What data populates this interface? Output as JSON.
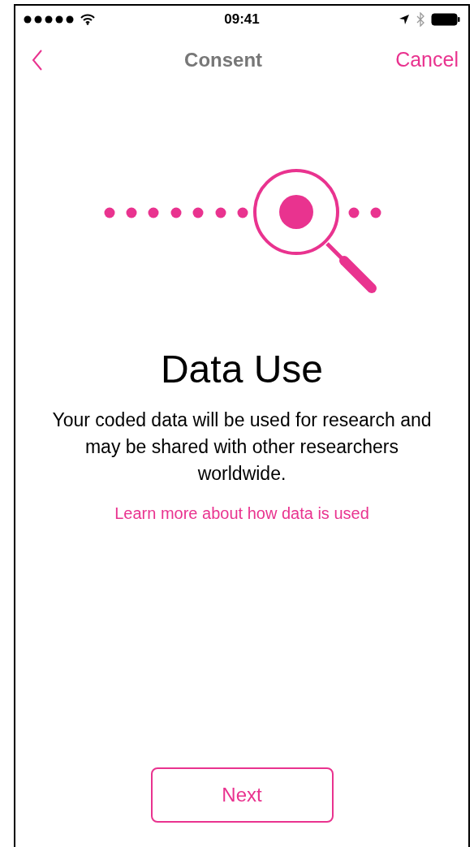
{
  "status_bar": {
    "time": "09:41"
  },
  "nav_bar": {
    "title": "Consent",
    "cancel": "Cancel"
  },
  "title": "Data Use",
  "body": "Your coded data will be used for research and may be shared with other researchers worldwide.",
  "link": "Learn more about how data is used",
  "next_button": "Next"
}
